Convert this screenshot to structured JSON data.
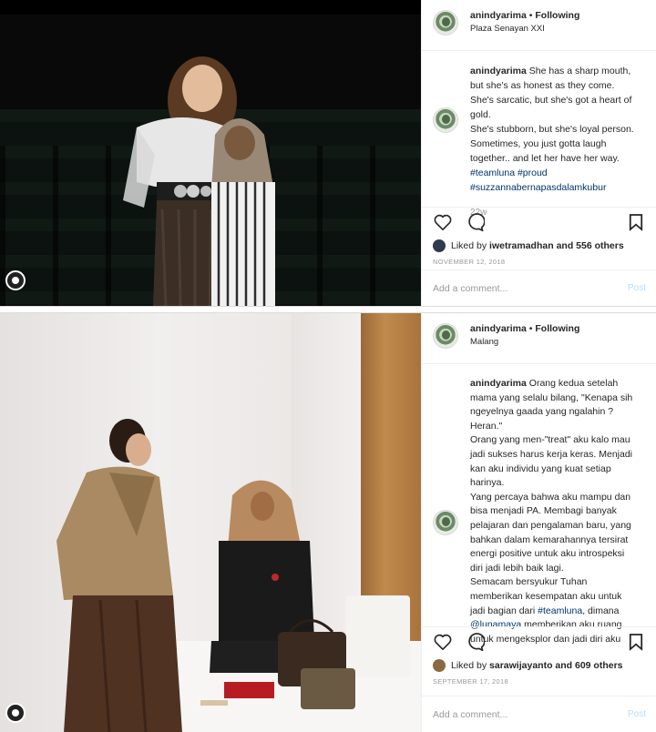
{
  "posts": [
    {
      "username": "anindyarima",
      "follow_status": "Following",
      "location": "Plaza Senayan XXI",
      "caption_user": "anindyarima",
      "caption_lines": [
        "She has a sharp mouth,",
        "but she's as honest as they come.",
        "She's sarcatic, but she's got a heart of",
        "gold.",
        "She's stubborn, but she's loyal person.",
        "Sometimes, you just gotta laugh",
        "together.. and let her have her way."
      ],
      "hashtags_line1": "#teamluna #proud",
      "hashtags_line2": "#suzzannabernapasdalamkubur",
      "time_ago": "22w",
      "liked_by_prefix": "Liked by",
      "liked_by_user": "iwetramadhan",
      "likes_rest": "and 556 others",
      "date": "NOVEMBER 12, 2018",
      "comment_placeholder": "Add a comment...",
      "post_label": "Post"
    },
    {
      "username": "anindyarima",
      "follow_status": "Following",
      "location": "Malang",
      "caption_user": "anindyarima",
      "caption_lines": [
        "Orang kedua setelah",
        "mama yang selalu bilang, \"Kenapa sih",
        "ngeyelnya gaada yang ngalahin ?",
        "Heran.\"",
        "Orang yang men-\"treat\" aku kalo mau",
        "jadi sukses harus kerja keras. Menjadi",
        "kan aku individu yang kuat setiap",
        "harinya.",
        "Yang percaya bahwa aku mampu dan",
        "bisa menjadi PA. Membagi banyak",
        "pelajaran dan pengalaman baru, yang",
        "bahkan dalam kemarahannya tersirat",
        "energi positive untuk aku introspeksi",
        "diri jadi lebih baik lagi.",
        "Semacam bersyukur Tuhan",
        "memberikan kesempatan aku untuk"
      ],
      "line_a_pre": "jadi bagian dari ",
      "line_a_tag": "#teamluna",
      "line_a_post": ", dimana",
      "line_b_tag": "@lunamaya",
      "line_b_post": " memberikan aku ruang",
      "line_c": "untuk mengeksplor dan jadi diri aku",
      "liked_by_prefix": "Liked by",
      "liked_by_user": "sarawijayanto",
      "likes_rest": "and 609 others",
      "date": "SEPTEMBER 17, 2018",
      "comment_placeholder": "Add a comment...",
      "post_label": "Post"
    }
  ],
  "icons": [
    "heart-icon",
    "comment-icon",
    "bookmark-icon",
    "user-tag-icon"
  ],
  "colors": {
    "link": "#003569",
    "muted": "#999999",
    "post_disabled": "#b2dffc"
  }
}
